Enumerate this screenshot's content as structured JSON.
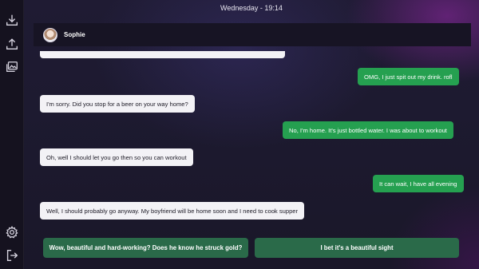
{
  "topbar": {
    "datetime": "Wednesday - 19:14"
  },
  "sidebar": {
    "icons": [
      "download-icon",
      "upload-icon",
      "gallery-icon",
      "settings-icon",
      "exit-icon"
    ]
  },
  "chat": {
    "contact_name": "Sophie",
    "messages": [
      {
        "from": "me",
        "text": "OMG, I just spit out my drink. rofl"
      },
      {
        "from": "sophie",
        "text": "I'm sorry. Did you stop for a beer on your way home?"
      },
      {
        "from": "me",
        "text": "No, I'm home. It's just bottled water. I was about to workout"
      },
      {
        "from": "sophie",
        "text": "Oh, well I should let you go then so you can workout"
      },
      {
        "from": "me",
        "text": "It can wait, I have all evening"
      },
      {
        "from": "sophie",
        "text": "Well, I should probably go anyway. My boyfriend will be home soon and I need to cook supper"
      }
    ]
  },
  "choices": [
    {
      "label": "Wow, beautiful and hard-working? Does he know he struck gold?"
    },
    {
      "label": "I bet it's a beautiful sight"
    }
  ],
  "colors": {
    "incoming_bubble": "#f3f2f6",
    "outgoing_bubble": "#25a050",
    "choice_button": "#2a6a49",
    "sidebar": "#15121f"
  }
}
